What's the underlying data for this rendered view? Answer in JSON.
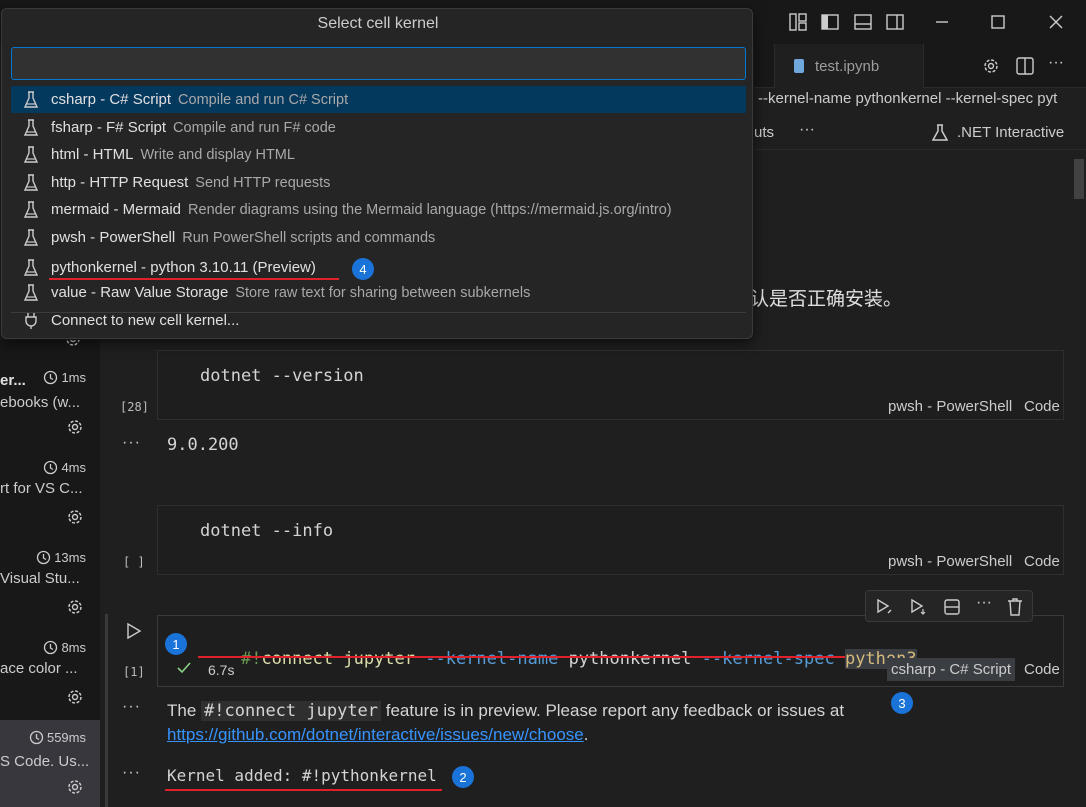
{
  "quickpick": {
    "title": "Select cell kernel",
    "input_value": "",
    "items": [
      {
        "label": "csharp - C# Script",
        "desc": "Compile and run C# Script"
      },
      {
        "label": "fsharp - F# Script",
        "desc": "Compile and run F# code"
      },
      {
        "label": "html - HTML",
        "desc": "Write and display HTML"
      },
      {
        "label": "http - HTTP Request",
        "desc": "Send HTTP requests"
      },
      {
        "label": "mermaid - Mermaid",
        "desc": "Render diagrams using the Mermaid language (https://mermaid.js.org/intro)"
      },
      {
        "label": "pwsh - PowerShell",
        "desc": "Run PowerShell scripts and commands"
      },
      {
        "label": "pythonkernel - python 3.10.11 (Preview)",
        "desc": ""
      },
      {
        "label": "value - Raw Value Storage",
        "desc": "Store raw text for sharing between subkernels"
      }
    ],
    "connect_label": "Connect to new cell kernel..."
  },
  "tab": {
    "label": "test.ipynb"
  },
  "breadcrumb": "--kernel-name pythonkernel --kernel-spec pyt",
  "toolbar": {
    "outputs": "uts",
    "more": "···",
    "kernel_label": ".NET Interactive"
  },
  "markdown_fragment": "认是否正确安装。",
  "side_entries": [
    {
      "time": "1ms",
      "title": "er...",
      "subtitle": "ebooks (w..."
    },
    {
      "time": "4ms",
      "title": "rt for VS C..."
    },
    {
      "time": "13ms",
      "title": "Visual Stu..."
    },
    {
      "time": "8ms",
      "title": "ace color ..."
    },
    {
      "time": "559ms",
      "title": "S Code. Us..."
    }
  ],
  "cells": [
    {
      "count": "[28]",
      "code": "dotnet --version",
      "kernel": "pwsh - PowerShell",
      "lang": "Code",
      "output": "9.0.200"
    },
    {
      "count": "[ ]",
      "code": "dotnet --info",
      "kernel": "pwsh - PowerShell",
      "lang": "Code"
    },
    {
      "count": "[1]",
      "code_parts": [
        "#!",
        "connect",
        " ",
        "jupyter",
        " ",
        "--kernel-name",
        " ",
        "pythonkernel",
        " ",
        "--kernel-spec",
        " ",
        "python3"
      ],
      "kernel": "csharp - C# Script",
      "lang": "Code",
      "duration": "6.7s"
    }
  ],
  "output": {
    "preview_prefix": "The ",
    "preview_code": "#!connect jupyter",
    "preview_suffix": " feature is in preview. Please report any feedback or issues at",
    "link": "https://github.com/dotnet/interactive/issues/new/choose",
    "link_suffix": ".",
    "kernel_added": "Kernel added: #!pythonkernel"
  },
  "badges": [
    "1",
    "2",
    "3",
    "4"
  ],
  "colors": {
    "accent": "#0078d4",
    "badge": "#1a73d8",
    "annotation_red": "#e0202a",
    "link": "#3794ff"
  }
}
